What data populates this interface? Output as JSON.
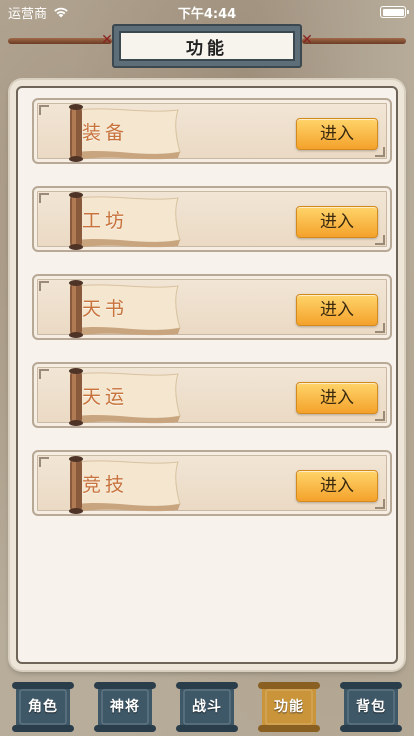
{
  "status_bar": {
    "carrier": "运营商",
    "time": "下午4:44"
  },
  "header": {
    "title": "功能"
  },
  "features": [
    {
      "name": "装备",
      "button": "进入"
    },
    {
      "name": "工坊",
      "button": "进入"
    },
    {
      "name": "天书",
      "button": "进入"
    },
    {
      "name": "天运",
      "button": "进入"
    },
    {
      "name": "竞技",
      "button": "进入"
    }
  ],
  "nav": {
    "tabs": [
      {
        "label": "角色",
        "active": false
      },
      {
        "label": "神将",
        "active": false
      },
      {
        "label": "战斗",
        "active": false
      },
      {
        "label": "功能",
        "active": true
      },
      {
        "label": "背包",
        "active": false
      }
    ]
  },
  "icons": {
    "wifi": "wifi-icon",
    "battery": "battery-icon",
    "scroll": "scroll-icon"
  },
  "colors": {
    "button_gradient_top": "#ffd46a",
    "button_gradient_bottom": "#f4a22b",
    "feature_text": "#c8733d",
    "nav_tab_bg": "#3e5868",
    "nav_tab_active_bg": "#c9943a"
  }
}
